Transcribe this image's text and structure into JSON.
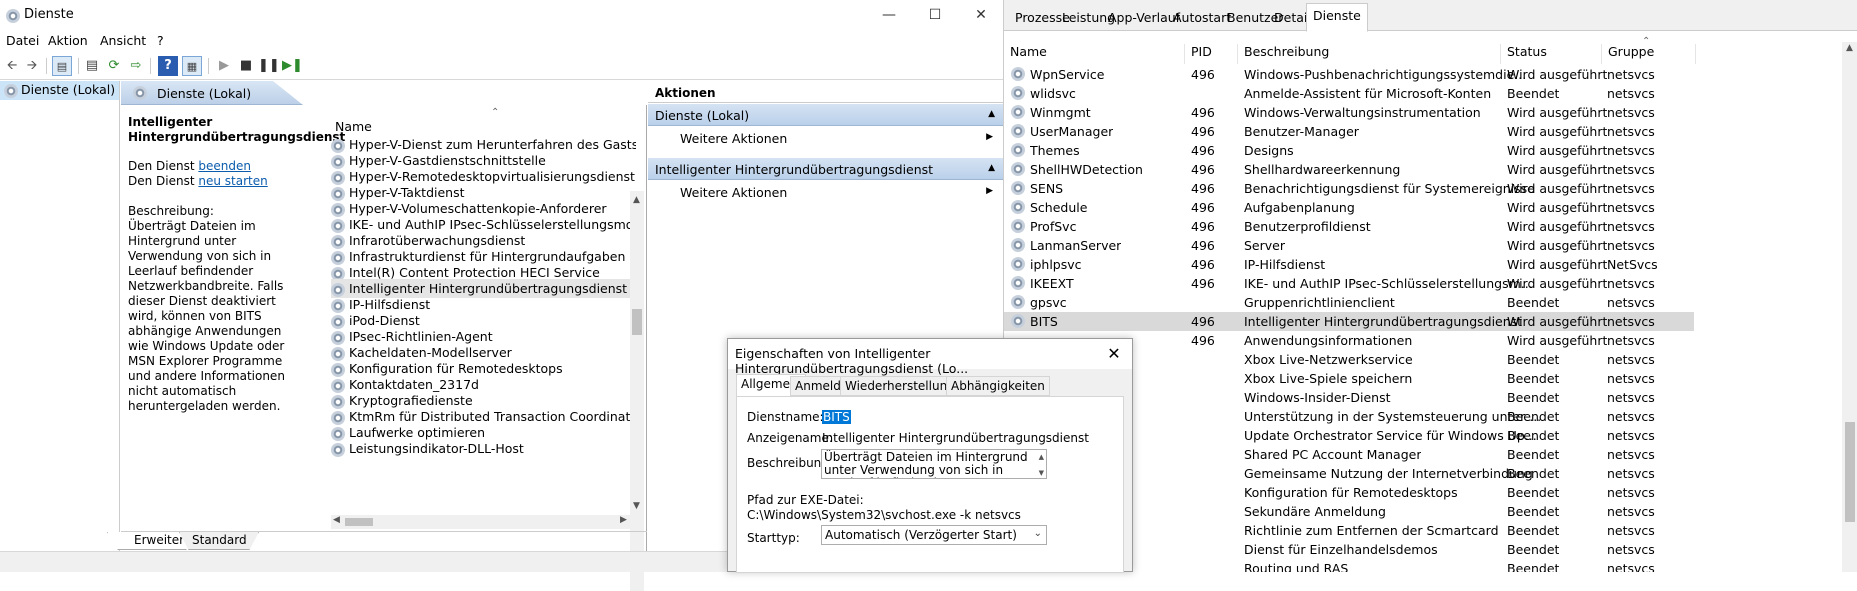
{
  "mmc": {
    "title": "Dienste",
    "menu": [
      "Datei",
      "Aktion",
      "Ansicht",
      "?"
    ],
    "tree_root": "Dienste (Lokal)",
    "center_header": "Dienste (Lokal)",
    "desc": {
      "title": "Intelligenter Hintergrundübertragungsdienst",
      "stop_prefix": "Den Dienst",
      "stop_link": "beenden",
      "restart_prefix": "Den Dienst",
      "restart_link": "neu starten",
      "desc_label": "Beschreibung:",
      "desc_text": "Überträgt Dateien im Hintergrund unter Verwendung von sich in Leerlauf befindender Netzwerkbandbreite. Falls dieser Dienst deaktiviert wird, können von BITS abhängige Anwendungen wie Windows Update oder MSN Explorer Programme und andere Informationen nicht automatisch heruntergeladen werden."
    },
    "list_header": "Name",
    "services": [
      "Hyper-V-Dienst zum Herunterfahren des Gasts",
      "Hyper-V-Gastdienstschnittstelle",
      "Hyper-V-Remotedesktopvirtualisierungsdienst",
      "Hyper-V-Taktdienst",
      "Hyper-V-Volumeschattenkopie-Anforderer",
      "IKE- und AuthIP IPsec-Schlüsselerstellungsmodule",
      "Infrarotüberwachungsdienst",
      "Infrastrukturdienst für Hintergrundaufgaben",
      "Intel(R) Content Protection HECI Service",
      "Intelligenter Hintergrundübertragungsdienst",
      "IP-Hilfsdienst",
      "iPod-Dienst",
      "IPsec-Richtlinien-Agent",
      "Kacheldaten-Modellserver",
      "Konfiguration für Remotedesktops",
      "Kontaktdaten_2317d",
      "Kryptografiedienste",
      "KtmRm für Distributed Transaction Coordinator",
      "Laufwerke optimieren",
      "Leistungsindikator-DLL-Host"
    ],
    "selected_index": 9,
    "bottom_tabs": [
      "Erweitert",
      "Standard"
    ],
    "actions": {
      "header": "Aktionen",
      "sec1": "Dienste (Lokal)",
      "sec1_item": "Weitere Aktionen",
      "sec2": "Intelligenter Hintergrundübertragungsdienst",
      "sec2_item": "Weitere Aktionen"
    }
  },
  "tm": {
    "tabs": [
      "Prozesse",
      "Leistung",
      "App-Verlauf",
      "Autostart",
      "Benutzer",
      "Details",
      "Dienste"
    ],
    "active_tab": 6,
    "columns": [
      "Name",
      "PID",
      "Beschreibung",
      "Status",
      "Gruppe"
    ],
    "rows": [
      {
        "name": "WpnService",
        "pid": "496",
        "desc": "Windows-Pushbenachrichtigungssystemdie...",
        "status": "Wird ausgeführt",
        "group": "netsvcs"
      },
      {
        "name": "wlidsvc",
        "pid": "",
        "desc": "Anmelde-Assistent für Microsoft-Konten",
        "status": "Beendet",
        "group": "netsvcs"
      },
      {
        "name": "Winmgmt",
        "pid": "496",
        "desc": "Windows-Verwaltungsinstrumentation",
        "status": "Wird ausgeführt",
        "group": "netsvcs"
      },
      {
        "name": "UserManager",
        "pid": "496",
        "desc": "Benutzer-Manager",
        "status": "Wird ausgeführt",
        "group": "netsvcs"
      },
      {
        "name": "Themes",
        "pid": "496",
        "desc": "Designs",
        "status": "Wird ausgeführt",
        "group": "netsvcs"
      },
      {
        "name": "ShellHWDetection",
        "pid": "496",
        "desc": "Shellhardwareerkennung",
        "status": "Wird ausgeführt",
        "group": "netsvcs"
      },
      {
        "name": "SENS",
        "pid": "496",
        "desc": "Benachrichtigungsdienst für Systemereignisse",
        "status": "Wird ausgeführt",
        "group": "netsvcs"
      },
      {
        "name": "Schedule",
        "pid": "496",
        "desc": "Aufgabenplanung",
        "status": "Wird ausgeführt",
        "group": "netsvcs"
      },
      {
        "name": "ProfSvc",
        "pid": "496",
        "desc": "Benutzerprofildienst",
        "status": "Wird ausgeführt",
        "group": "netsvcs"
      },
      {
        "name": "LanmanServer",
        "pid": "496",
        "desc": "Server",
        "status": "Wird ausgeführt",
        "group": "netsvcs"
      },
      {
        "name": "iphlpsvc",
        "pid": "496",
        "desc": "IP-Hilfsdienst",
        "status": "Wird ausgeführt",
        "group": "NetSvcs"
      },
      {
        "name": "IKEEXT",
        "pid": "496",
        "desc": "IKE- und AuthIP IPsec-Schlüsselerstellungsm...",
        "status": "Wird ausgeführt",
        "group": "netsvcs"
      },
      {
        "name": "gpsvc",
        "pid": "",
        "desc": "Gruppenrichtlinienclient",
        "status": "Beendet",
        "group": "netsvcs"
      },
      {
        "name": "BITS",
        "pid": "496",
        "desc": "Intelligenter Hintergrundübertragungsdienst",
        "status": "Wird ausgeführt",
        "group": "netsvcs"
      },
      {
        "name": "",
        "pid": "496",
        "desc": "Anwendungsinformationen",
        "status": "Wird ausgeführt",
        "group": "netsvcs"
      },
      {
        "name": "",
        "pid": "",
        "desc": "Xbox Live-Netzwerkservice",
        "status": "Beendet",
        "group": "netsvcs"
      },
      {
        "name": "",
        "pid": "",
        "desc": "Xbox Live-Spiele speichern",
        "status": "Beendet",
        "group": "netsvcs"
      },
      {
        "name": "",
        "pid": "",
        "desc": "Windows-Insider-Dienst",
        "status": "Beendet",
        "group": "netsvcs"
      },
      {
        "name": "",
        "pid": "",
        "desc": "Unterstützung in der Systemsteuerung unter ...",
        "status": "Beendet",
        "group": "netsvcs"
      },
      {
        "name": "",
        "pid": "",
        "desc": "Update Orchestrator Service für Windows Up...",
        "status": "Beendet",
        "group": "netsvcs"
      },
      {
        "name": "",
        "pid": "",
        "desc": "Shared PC Account Manager",
        "status": "Beendet",
        "group": "netsvcs"
      },
      {
        "name": "",
        "pid": "",
        "desc": "Gemeinsame Nutzung der Internetverbindung",
        "status": "Beendet",
        "group": "netsvcs"
      },
      {
        "name": "",
        "pid": "",
        "desc": "Konfiguration für Remotedesktops",
        "status": "Beendet",
        "group": "netsvcs"
      },
      {
        "name": "",
        "pid": "",
        "desc": "Sekundäre Anmeldung",
        "status": "Beendet",
        "group": "netsvcs"
      },
      {
        "name": "",
        "pid": "",
        "desc": "Richtlinie zum Entfernen der Scmartcard",
        "status": "Beendet",
        "group": "netsvcs"
      },
      {
        "name": "",
        "pid": "",
        "desc": "Dienst für Einzelhandelsdemos",
        "status": "Beendet",
        "group": "netsvcs"
      },
      {
        "name": "",
        "pid": "",
        "desc": "Routing und RAS",
        "status": "Beendet",
        "group": "netsvcs"
      }
    ],
    "selected_row": 13
  },
  "dialog": {
    "title": "Eigenschaften von Intelligenter Hintergrundübertragungsdienst (Lo...",
    "tabs": [
      "Allgemein",
      "Anmelden",
      "Wiederherstellung",
      "Abhängigkeiten"
    ],
    "service_name_label": "Dienstname:",
    "service_name": "BITS",
    "display_name_label": "Anzeigename:",
    "display_name": "Intelligenter Hintergrundübertragungsdienst",
    "description_label": "Beschreibung:",
    "description": "Überträgt Dateien im Hintergrund unter Verwendung von sich in Leerlauf befindender",
    "path_label": "Pfad zur EXE-Datei:",
    "path": "C:\\Windows\\System32\\svchost.exe -k netsvcs",
    "starttype_label": "Starttyp:",
    "starttype": "Automatisch (Verzögerter Start)"
  }
}
